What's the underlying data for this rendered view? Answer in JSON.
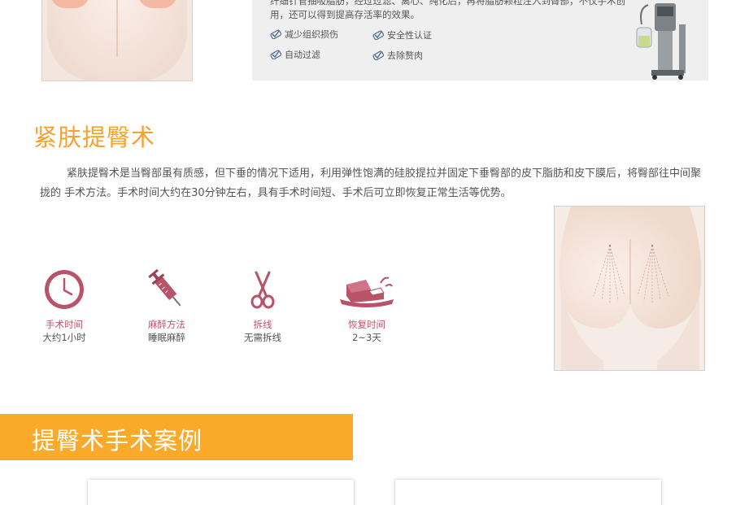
{
  "top_panel": {
    "desc_line1": "纤细针管抽吸脂肪，经过过滤、离心、纯化后，再将脂肪颗粒注入到臀部，不仅手术创伤小，恢复快，还具有丰臀塑形的作",
    "desc_line2": "用，还可以得到提高存活率的效果。",
    "features": [
      {
        "label": "减少组织损伤",
        "icon": "checkmark-pen-icon"
      },
      {
        "label": "安全性认证",
        "icon": "checkmark-pen-icon"
      },
      {
        "label": "自动过滤",
        "icon": "checkmark-pen-icon"
      },
      {
        "label": "去除赘肉",
        "icon": "checkmark-pen-icon"
      }
    ]
  },
  "section": {
    "title": "紧肤提臀术",
    "description": "紧肤提臀术是当臀部虽有质感，但下垂的情况下适用，利用弹性饱满的硅胶提拉并固定下垂臀部的皮下脂肪和皮下膜后，将臀部往中间聚拢的 手术方法。手术时间大约在30分钟左右，具有手术时间短、手术后可立即恢复正常生活等优势。",
    "info": [
      {
        "label": "手术时间",
        "value": "大约1小时",
        "icon": "clock-icon"
      },
      {
        "label": "麻醉方法",
        "value": "睡眠麻醉",
        "icon": "syringe-icon"
      },
      {
        "label": "拆线",
        "value": "无需拆线",
        "icon": "scissors-icon"
      },
      {
        "label": "恢复时间",
        "value": "2~3天",
        "icon": "bandage-icon"
      }
    ]
  },
  "cases": {
    "banner_title": "提臀术手术案例"
  },
  "colors": {
    "accent_orange": "#f4a230",
    "banner_orange": "#fba929",
    "icon_rose": "#b8536a"
  }
}
